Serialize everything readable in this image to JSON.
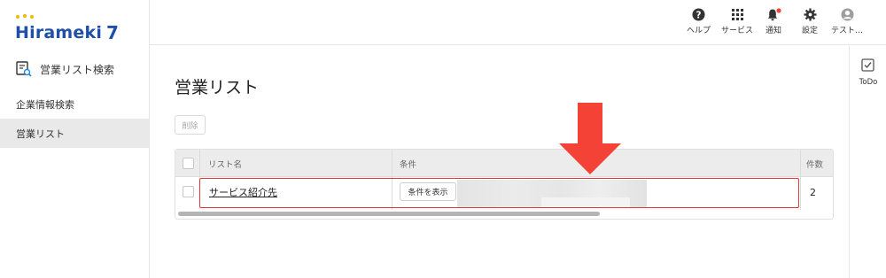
{
  "brand": {
    "name": "Hirameki 7",
    "logo_text": "Hirameki",
    "logo_num": "7"
  },
  "sidebar": {
    "search_label": "営業リスト検索",
    "items": [
      {
        "label": "企業情報検索",
        "active": false
      },
      {
        "label": "営業リスト",
        "active": true
      }
    ]
  },
  "topbar": {
    "items": [
      {
        "label": "ヘルプ",
        "icon": "help-icon"
      },
      {
        "label": "サービス",
        "icon": "grid-icon"
      },
      {
        "label": "通知",
        "icon": "bell-icon",
        "badge": true
      },
      {
        "label": "設定",
        "icon": "gear-icon"
      },
      {
        "label": "テスト…",
        "icon": "user-icon"
      }
    ]
  },
  "rightbar": {
    "todo_label": "ToDo"
  },
  "main": {
    "title": "営業リスト",
    "delete_label": "削除",
    "table": {
      "headers": {
        "name": "リスト名",
        "condition": "条件",
        "count": "件数"
      },
      "rows": [
        {
          "name": "サービス紹介先",
          "condition_button": "条件を表示",
          "count": "2"
        }
      ]
    }
  },
  "colors": {
    "brand_blue": "#1f4fa8",
    "accent_red": "#f44336",
    "active_bg": "#e9e9ea"
  }
}
